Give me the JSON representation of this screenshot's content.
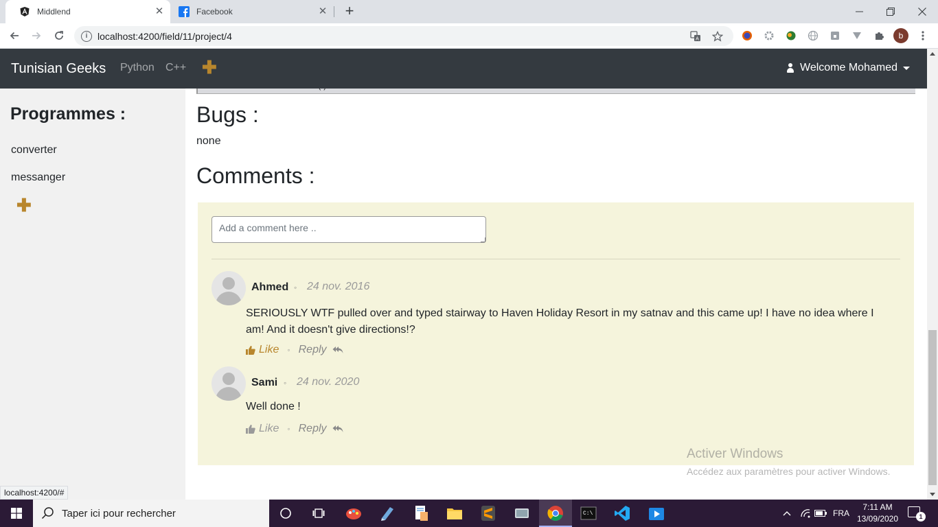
{
  "browser": {
    "tabs": [
      {
        "title": "Middlend",
        "active": true,
        "icon": "angular-icon"
      },
      {
        "title": "Facebook",
        "active": false,
        "icon": "facebook-icon"
      }
    ],
    "url": "localhost:4200/field/11/project/4",
    "profile_initial": "b",
    "status_url": "localhost:4200/#"
  },
  "navbar": {
    "brand": "Tunisian Geeks",
    "links": [
      "Python",
      "C++"
    ],
    "plus": "✚",
    "user": "Welcome Mohamed"
  },
  "sidebar": {
    "title": "Programmes :",
    "items": [
      "converter",
      "messanger"
    ],
    "plus": "✚"
  },
  "main": {
    "code_line": "self.initWindow()",
    "bugs_title": "Bugs :",
    "bugs_text": "none",
    "comments_title": "Comments :",
    "comment_placeholder": "Add a comment here .."
  },
  "comments": [
    {
      "author": "Ahmed",
      "separator": "◦",
      "date": "24 nov. 2016",
      "text": "SERIOUSLY WTF pulled over and typed stairway to Haven Holiday Resort in my satnav and this came up! I have no idea where I am! And it doesn't give directions!?",
      "like_label": "Like",
      "reply_label": "Reply",
      "liked": true
    },
    {
      "author": "Sami",
      "separator": "◦",
      "date": "24 nov. 2020",
      "text": "Well done !",
      "like_label": "Like",
      "reply_label": "Reply",
      "liked": false
    }
  ],
  "watermark": {
    "line1": "Activer Windows",
    "line2": "Accédez aux paramètres pour activer Windows."
  },
  "taskbar": {
    "search_placeholder": "Taper ici pour rechercher",
    "language": "FRA",
    "time": "7:11 AM",
    "date": "13/09/2020",
    "notification_count": "1"
  },
  "colors": {
    "accent": "#b8862d",
    "navbar": "#343a40",
    "comment_panel": "#f5f4dc",
    "taskbar": "#2b1a36"
  }
}
